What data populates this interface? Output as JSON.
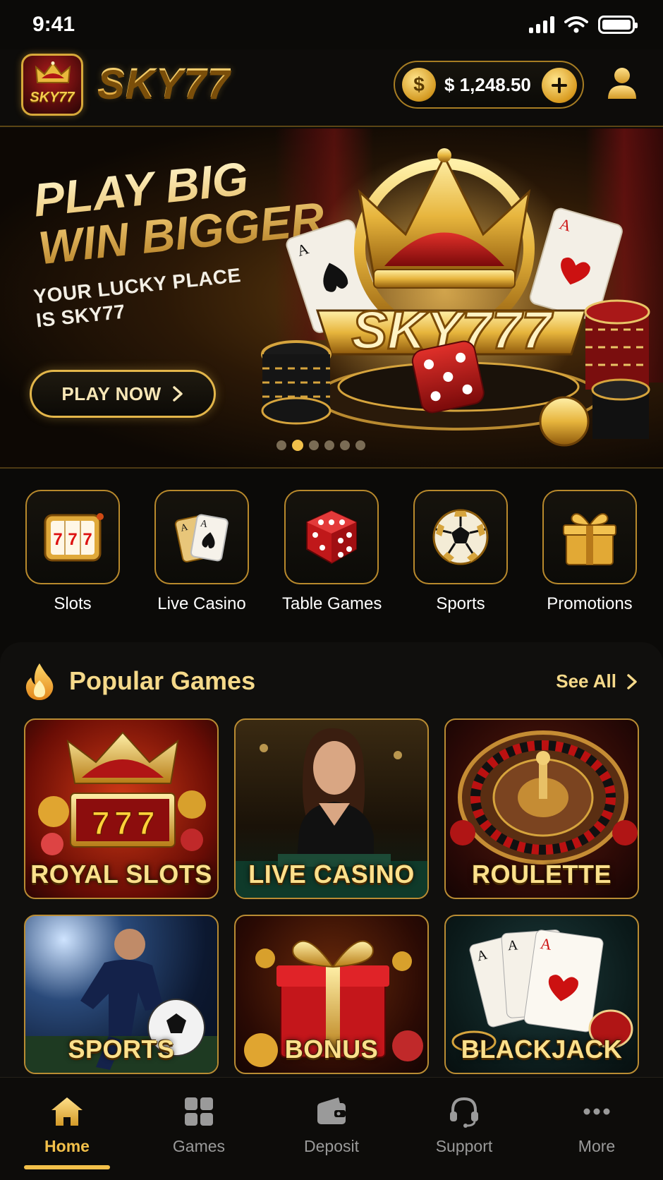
{
  "status_bar": {
    "time": "9:41"
  },
  "header": {
    "brand": "SKY77",
    "logo_text": "SKY77",
    "balance": "$ 1,248.50",
    "coin_symbol": "$"
  },
  "banner": {
    "title_line1": "PLAY BIG",
    "title_line2": "WIN BIGGER",
    "subtitle_line1": "YOUR LUCKY PLACE",
    "subtitle_line2": "IS SKY77",
    "cta_label": "PLAY NOW",
    "hero_text": "SKY777",
    "carousel": {
      "count": 6,
      "active_index": 1
    }
  },
  "categories": [
    {
      "label": "Slots",
      "icon": "slot-machine-icon"
    },
    {
      "label": "Live Casino",
      "icon": "playing-cards-icon"
    },
    {
      "label": "Table Games",
      "icon": "dice-icon"
    },
    {
      "label": "Sports",
      "icon": "soccer-ball-icon"
    },
    {
      "label": "Promotions",
      "icon": "gift-icon"
    }
  ],
  "popular": {
    "title": "Popular Games",
    "see_all": "See All",
    "games": [
      {
        "name": "ROYAL SLOTS"
      },
      {
        "name": "LIVE CASINO"
      },
      {
        "name": "ROULETTE"
      },
      {
        "name": "SPORTS"
      },
      {
        "name": "BONUS"
      },
      {
        "name": "BLACKJACK"
      }
    ]
  },
  "bottom_nav": {
    "items": [
      {
        "label": "Home",
        "icon": "home-icon",
        "active": true
      },
      {
        "label": "Games",
        "icon": "grid-icon",
        "active": false
      },
      {
        "label": "Deposit",
        "icon": "wallet-icon",
        "active": false
      },
      {
        "label": "Support",
        "icon": "headset-icon",
        "active": false
      },
      {
        "label": "More",
        "icon": "more-dots-icon",
        "active": false
      }
    ]
  },
  "colors": {
    "gold": "#f2c04a",
    "gold_dark": "#b8892c",
    "background": "#0b0a08",
    "inactive_nav": "#9a9a9a"
  }
}
